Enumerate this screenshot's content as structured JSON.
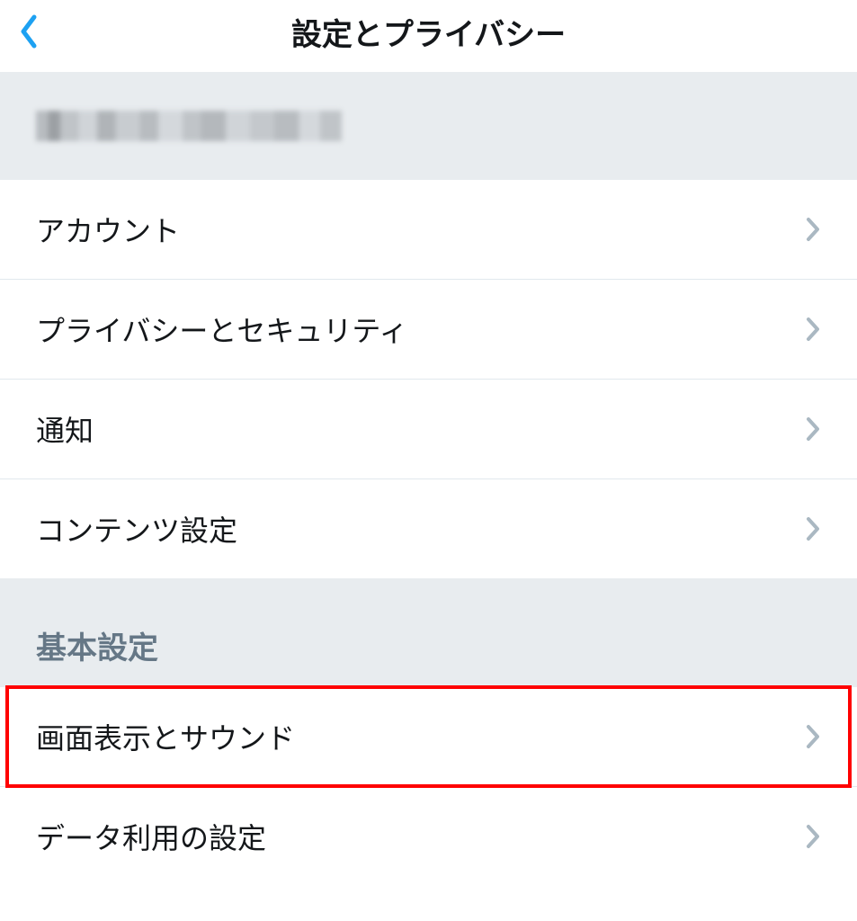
{
  "header": {
    "title": "設定とプライバシー"
  },
  "sections": {
    "main": {
      "items": [
        {
          "label": "アカウント"
        },
        {
          "label": "プライバシーとセキュリティ"
        },
        {
          "label": "通知"
        },
        {
          "label": "コンテンツ設定"
        }
      ]
    },
    "basic": {
      "title": "基本設定",
      "items": [
        {
          "label": "画面表示とサウンド"
        },
        {
          "label": "データ利用の設定"
        }
      ]
    }
  }
}
